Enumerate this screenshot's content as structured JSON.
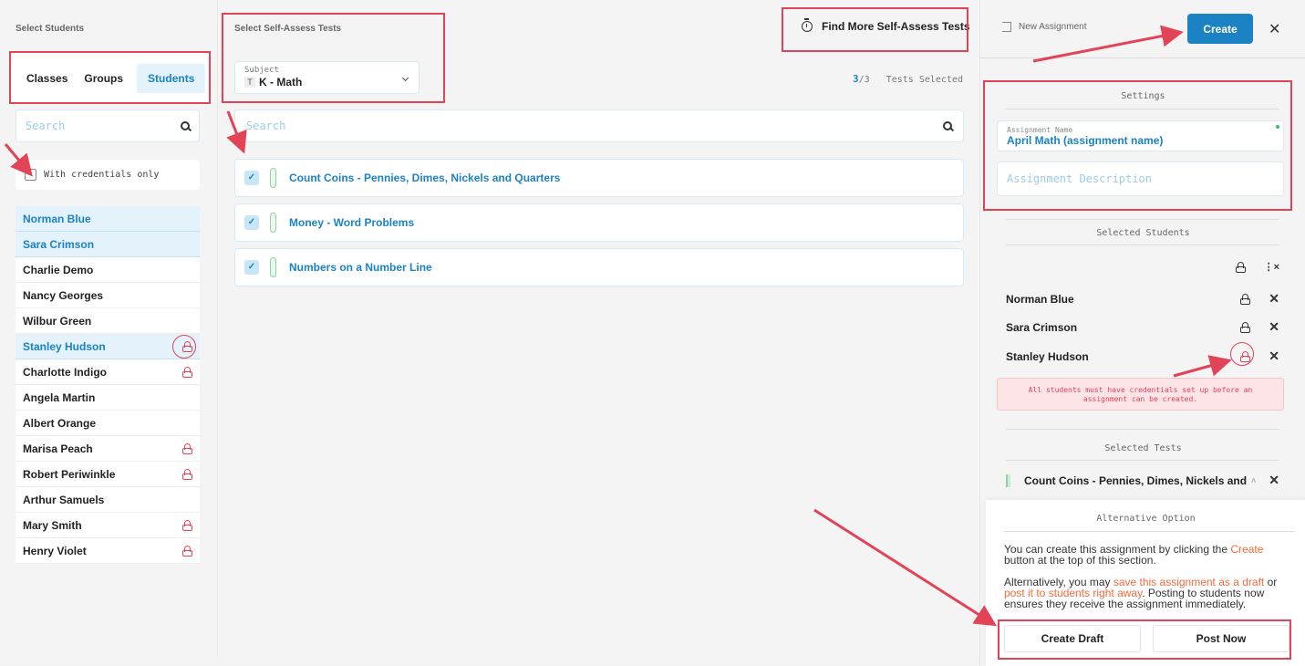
{
  "left": {
    "title": "Select Students",
    "segments": [
      "Classes",
      "Groups",
      "Students"
    ],
    "search_placeholder": "Search",
    "credentials_label": "With credentials only",
    "students": [
      {
        "name": "Norman Blue",
        "selected": true,
        "lock": false
      },
      {
        "name": "Sara Crimson",
        "selected": true,
        "lock": false
      },
      {
        "name": "Charlie Demo",
        "selected": false,
        "lock": false
      },
      {
        "name": "Nancy Georges",
        "selected": false,
        "lock": false
      },
      {
        "name": "Wilbur Green",
        "selected": false,
        "lock": false
      },
      {
        "name": "Stanley Hudson",
        "selected": true,
        "lock": true
      },
      {
        "name": "Charlotte Indigo",
        "selected": false,
        "lock": true
      },
      {
        "name": "Angela Martin",
        "selected": false,
        "lock": false
      },
      {
        "name": "Albert Orange",
        "selected": false,
        "lock": false
      },
      {
        "name": "Marisa Peach",
        "selected": false,
        "lock": true
      },
      {
        "name": "Robert Periwinkle",
        "selected": false,
        "lock": true
      },
      {
        "name": "Arthur Samuels",
        "selected": false,
        "lock": false
      },
      {
        "name": "Mary Smith",
        "selected": false,
        "lock": true
      },
      {
        "name": "Henry Violet",
        "selected": false,
        "lock": true
      }
    ]
  },
  "middle": {
    "title": "Select Self-Assess Tests",
    "subject_label": "Subject",
    "subject_icon": "T",
    "subject_value": "K - Math",
    "find_more": "Find More Self-Assess Tests",
    "count_selected": "3",
    "count_total": "/3",
    "count_suffix": "Tests Selected",
    "search_placeholder": "Search",
    "tests": [
      "Count Coins - Pennies, Dimes, Nickels and Quarters",
      "Money - Word Problems",
      "Numbers on a Number Line"
    ]
  },
  "right": {
    "new_assignment": "New Assignment",
    "create": "Create",
    "settings_title": "Settings",
    "assign_name_label": "Assignment Name",
    "assign_name_value": "April Math (assignment name)",
    "assign_desc_placeholder": "Assignment Description",
    "selected_students_title": "Selected Students",
    "selected_students": [
      "Norman Blue",
      "Sara Crimson",
      "Stanley Hudson"
    ],
    "error": "All students must have credentials set up before an assignment can be created.",
    "selected_tests_title": "Selected Tests",
    "selected_test": "Count Coins - Pennies, Dimes, Nickels and",
    "alt_title": "Alternative Option",
    "alt_p1_a": "You can create this assignment by clicking the ",
    "alt_p1_link": "Create",
    "alt_p1_b": " button at the top of this section.",
    "alt_p2_a": "Alternatively, you may ",
    "alt_p2_link1": "save this assignment as a draft",
    "alt_p2_b": " or ",
    "alt_p2_link2": "post it to students right away",
    "alt_p2_c": ". Posting to students now ensures they receive the assignment immediately.",
    "create_draft": "Create Draft",
    "post_now": "Post Now"
  },
  "colors": {
    "accent": "#1b82c4",
    "error": "#e24357",
    "link_orange": "#f26a3b",
    "annotation": "#e24357"
  }
}
